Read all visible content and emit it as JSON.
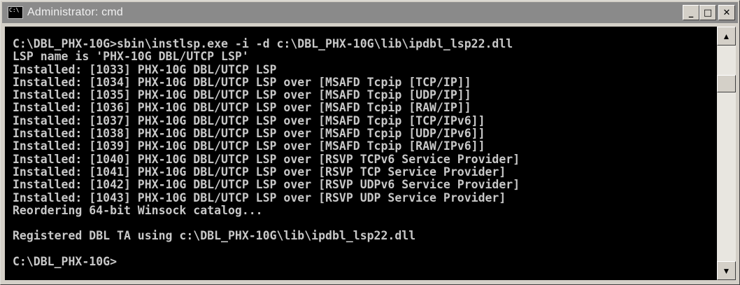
{
  "window": {
    "title": "Administrator: cmd",
    "icon_text": "C:\\",
    "buttons": {
      "minimize": "_",
      "maximize": "□",
      "close": "✕"
    }
  },
  "console": {
    "lines": [
      "C:\\DBL_PHX-10G>sbin\\instlsp.exe -i -d c:\\DBL_PHX-10G\\lib\\ipdbl_lsp22.dll",
      "LSP name is 'PHX-10G DBL/UTCP LSP'",
      "Installed: [1033] PHX-10G DBL/UTCP LSP",
      "Installed: [1034] PHX-10G DBL/UTCP LSP over [MSAFD Tcpip [TCP/IP]]",
      "Installed: [1035] PHX-10G DBL/UTCP LSP over [MSAFD Tcpip [UDP/IP]]",
      "Installed: [1036] PHX-10G DBL/UTCP LSP over [MSAFD Tcpip [RAW/IP]]",
      "Installed: [1037] PHX-10G DBL/UTCP LSP over [MSAFD Tcpip [TCP/IPv6]]",
      "Installed: [1038] PHX-10G DBL/UTCP LSP over [MSAFD Tcpip [UDP/IPv6]]",
      "Installed: [1039] PHX-10G DBL/UTCP LSP over [MSAFD Tcpip [RAW/IPv6]]",
      "Installed: [1040] PHX-10G DBL/UTCP LSP over [RSVP TCPv6 Service Provider]",
      "Installed: [1041] PHX-10G DBL/UTCP LSP over [RSVP TCP Service Provider]",
      "Installed: [1042] PHX-10G DBL/UTCP LSP over [RSVP UDPv6 Service Provider]",
      "Installed: [1043] PHX-10G DBL/UTCP LSP over [RSVP UDP Service Provider]",
      "Reordering 64-bit Winsock catalog...",
      "",
      "Registered DBL TA using c:\\DBL_PHX-10G\\lib\\ipdbl_lsp22.dll",
      "",
      "C:\\DBL_PHX-10G>"
    ]
  },
  "scrollbar": {
    "up_arrow": "▲",
    "down_arrow": "▼"
  },
  "colors": {
    "console_bg": "#000000",
    "console_text": "#c8c8c8",
    "titlebar_bg": "#8a8a8a",
    "window_frame": "#d4d0c8"
  }
}
